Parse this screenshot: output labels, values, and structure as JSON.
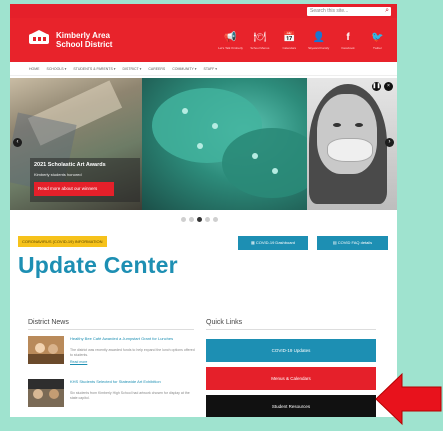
{
  "search": {
    "placeholder": "Search this site..."
  },
  "header": {
    "district_name_line1": "Kimberly Area",
    "district_name_line2": "School District",
    "quick_icons": [
      {
        "icon": "megaphone-icon",
        "glyph": "📢",
        "label": "Let's Talk Kimberly"
      },
      {
        "icon": "lunch-icon",
        "glyph": "🍽",
        "label": "School Menus"
      },
      {
        "icon": "calendar-icon",
        "glyph": "📅",
        "label": "Calendars"
      },
      {
        "icon": "person-icon",
        "glyph": "👤",
        "label": "Skyward Family"
      },
      {
        "icon": "facebook-icon",
        "glyph": "f",
        "label": "Facebook"
      },
      {
        "icon": "twitter-icon",
        "glyph": "🐦",
        "label": "Twitter"
      }
    ]
  },
  "nav": {
    "items": [
      "HOME",
      "SCHOOLS ▾",
      "STUDENTS & PARENTS ▾",
      "DISTRICT ▾",
      "CAREERS",
      "COMMUNITY ▾",
      "STAFF ▾"
    ]
  },
  "carousel": {
    "slide_title": "2021 Scholastic Art Awards",
    "slide_subtitle": "Kimberly students honored",
    "cta_label": "Read more about our winners",
    "prev_glyph": "‹",
    "next_glyph": "›",
    "pause_glyph": "❚❚",
    "close_glyph": "×",
    "dot_count": 5,
    "active_dot": 2
  },
  "update": {
    "tag": "CORONAVIRUS (COVID-19) INFORMATION",
    "title": "Update Center",
    "dashboard_button": "COVID-19 Dashboard",
    "faq_button": "COVID FAQ details"
  },
  "news": {
    "heading": "District News",
    "items": [
      {
        "title": "Healthy Bee Café Awarded a Jumpstart Grant for Lunches",
        "text": "The district was recently awarded funds to help expand the lunch options offered to students.",
        "more": "Read more"
      },
      {
        "title": "KHS Students Selected for Statewide Art Exhibition",
        "text": "Six students from Kimberly High School had artwork chosen for display at the state capitol.",
        "more": "Read more"
      }
    ]
  },
  "quick_links": {
    "heading": "Quick Links",
    "buttons": [
      {
        "label": "COVID-19 Updates",
        "color": "#1d8fb3"
      },
      {
        "label": "Menus & Calendars",
        "color": "#e5202a"
      },
      {
        "label": "Student Resources",
        "color": "#111111"
      }
    ]
  },
  "colors": {
    "brand_red": "#e5202a",
    "brand_blue": "#1d8fb3",
    "tag_yellow": "#f6c21b",
    "backdrop": "#9fe3cf"
  }
}
